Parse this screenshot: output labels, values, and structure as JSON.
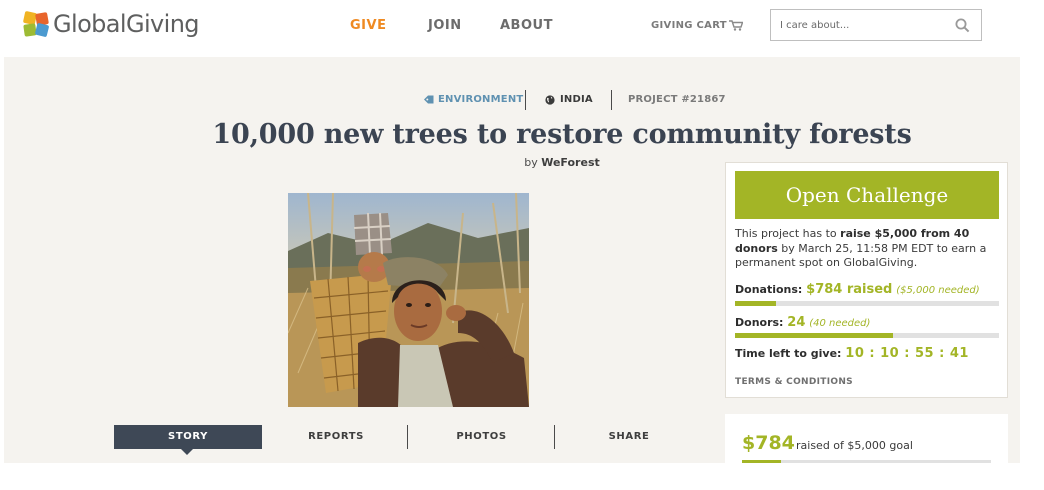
{
  "header": {
    "logo_text": "GlobalGiving",
    "nav": {
      "give": "GIVE",
      "join": "JOIN",
      "about": "ABOUT"
    },
    "cart_label": "GIVING CART",
    "search_placeholder": "I care about..."
  },
  "project": {
    "category": "ENVIRONMENT",
    "country": "INDIA",
    "project_id": "PROJECT #21867",
    "title": "10,000 new trees to restore community forests",
    "by_prefix": "by",
    "organization": "WeForest"
  },
  "tabs": [
    "STORY",
    "REPORTS",
    "PHOTOS",
    "SHARE"
  ],
  "challenge": {
    "banner": "Open Challenge",
    "desc_1": "This project has to ",
    "desc_bold": "raise $5,000 from 40 donors",
    "desc_2": " by March 25, 11:58 PM EDT to earn a permanent spot on GlobalGiving.",
    "donations_label": "Donations:",
    "donations_value": "$784 raised",
    "donations_needed": "($5,000 needed)",
    "donations_fraction": 0.157,
    "donors_label": "Donors:",
    "donors_value": "24",
    "donors_needed": "(40 needed)",
    "donors_fraction": 0.6,
    "time_label": "Time left to give:",
    "time_value": "10 : 10 : 55 : 41",
    "terms": "TERMS & CONDITIONS"
  },
  "raised": {
    "amount": "$784",
    "label": "raised of $5,000 goal",
    "fraction": 0.157
  },
  "colors": {
    "accent_green": "#a3b526",
    "nav_active": "#ef8a22",
    "tab_active": "#3e4856",
    "title": "#3b4452"
  },
  "icons": [
    "logo-mark-icon",
    "cart-icon",
    "search-icon",
    "tag-icon",
    "globe-icon"
  ]
}
